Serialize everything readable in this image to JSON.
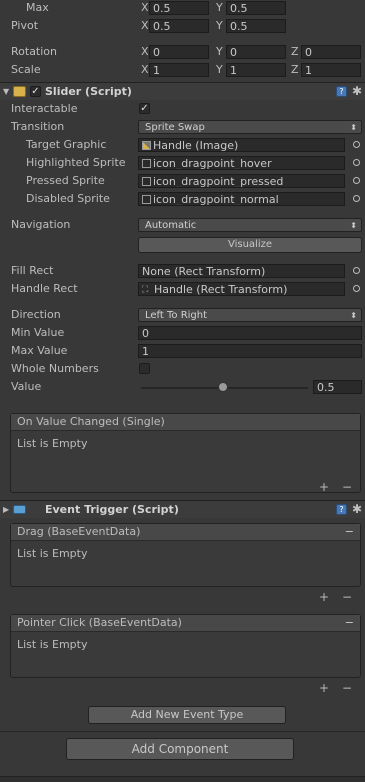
{
  "transform": {
    "max_label": "Max",
    "max_x": "0.5",
    "max_y": "0.5",
    "pivot_label": "Pivot",
    "pivot_x": "0.5",
    "pivot_y": "0.5",
    "rotation_label": "Rotation",
    "rotation_x": "0",
    "rotation_y": "0",
    "rotation_z": "0",
    "scale_label": "Scale",
    "scale_x": "1",
    "scale_y": "1",
    "scale_z": "1",
    "axis_x": "X",
    "axis_y": "Y",
    "axis_z": "Z"
  },
  "slider": {
    "title": "Slider (Script)",
    "interactable_label": "Interactable",
    "transition_label": "Transition",
    "transition_value": "Sprite Swap",
    "target_graphic_label": "Target Graphic",
    "target_graphic_value": "Handle (Image)",
    "highlighted_label": "Highlighted Sprite",
    "highlighted_value": "icon_dragpoint_hover",
    "pressed_label": "Pressed Sprite",
    "pressed_value": "icon_dragpoint_pressed",
    "disabled_label": "Disabled Sprite",
    "disabled_value": "icon_dragpoint_normal",
    "navigation_label": "Navigation",
    "navigation_value": "Automatic",
    "visualize_label": "Visualize",
    "fill_rect_label": "Fill Rect",
    "fill_rect_value": "None (Rect Transform)",
    "handle_rect_label": "Handle Rect",
    "handle_rect_value": "Handle (Rect Transform)",
    "direction_label": "Direction",
    "direction_value": "Left To Right",
    "min_value_label": "Min Value",
    "min_value": "0",
    "max_value_label": "Max Value",
    "max_value": "1",
    "whole_numbers_label": "Whole Numbers",
    "value_label": "Value",
    "value": "0.5",
    "on_value_changed_title": "On Value Changed (Single)",
    "list_empty": "List is Empty"
  },
  "event_trigger": {
    "title": "Event Trigger (Script)",
    "drag_title": "Drag (BaseEventData)",
    "pointer_click_title": "Pointer Click (BaseEventData)",
    "list_empty": "List is Empty",
    "add_event_label": "Add New Event Type"
  },
  "add_component_label": "Add Component",
  "glyphs": {
    "plus": "+",
    "minus": "−",
    "check": "✓"
  }
}
